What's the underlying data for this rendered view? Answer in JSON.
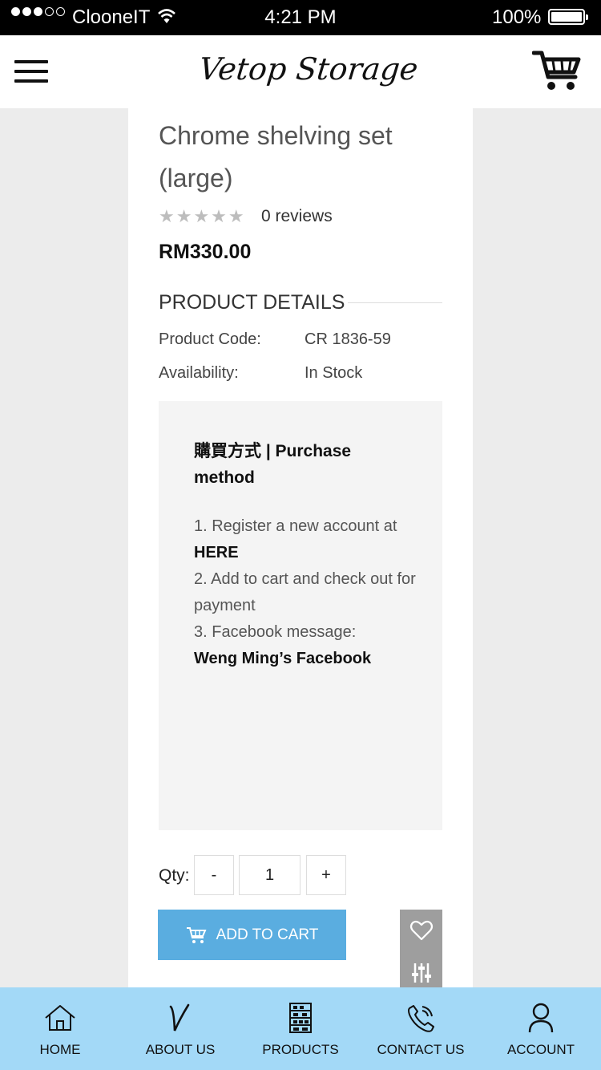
{
  "status_bar": {
    "carrier": "ClooneIT",
    "time": "4:21 PM",
    "battery": "100%"
  },
  "header": {
    "logo": "Vetop Storage"
  },
  "product": {
    "title": "Chrome shelving set (large)",
    "stars": "★★★★★",
    "rating": 0,
    "reviews": "0 reviews",
    "price": "RM330.00"
  },
  "details": {
    "heading": "PRODUCT DETAILS",
    "rows": [
      {
        "label": "Product Code:",
        "value": "CR 1836-59"
      },
      {
        "label": "Availability:",
        "value": "In Stock"
      }
    ]
  },
  "purchase": {
    "title": "購買方式 | Purchase method",
    "step1": "1. Register a new account at",
    "step1_link": "HERE",
    "step2": "2. Add to cart and check out for payment",
    "step3": "3. Facebook message:",
    "step3_link": "Weng Ming’s Facebook"
  },
  "quantity": {
    "label": "Qty:",
    "minus": "-",
    "value": "1",
    "plus": "+"
  },
  "actions": {
    "add_to_cart": "ADD TO CART"
  },
  "nav": [
    {
      "label": "HOME",
      "icon": "home-icon"
    },
    {
      "label": "ABOUT US",
      "icon": "about-icon"
    },
    {
      "label": "PRODUCTS",
      "icon": "shelf-icon"
    },
    {
      "label": "CONTACT US",
      "icon": "phone-icon"
    },
    {
      "label": "ACCOUNT",
      "icon": "user-icon"
    }
  ],
  "colors": {
    "accent": "#5aade0",
    "nav_bg": "#a3d9f7",
    "side_actions": "#9e9e9e"
  }
}
